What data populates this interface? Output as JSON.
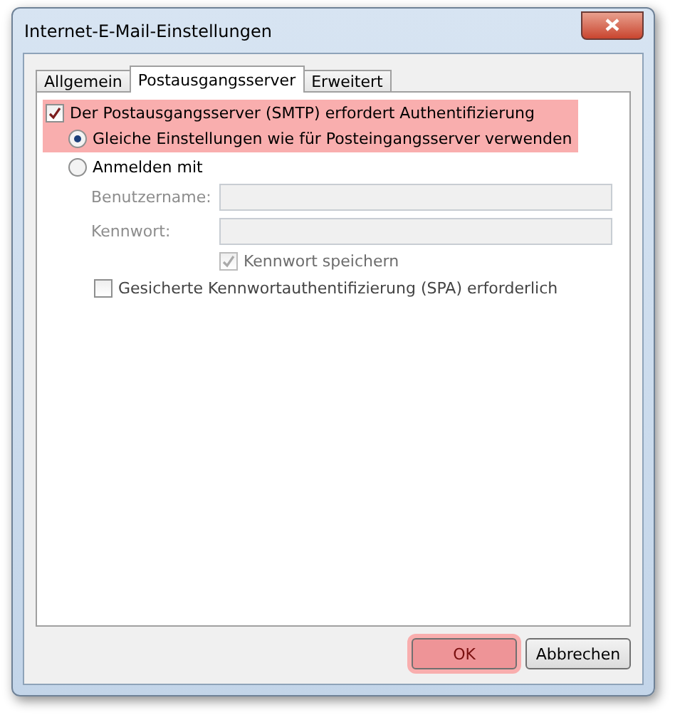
{
  "window": {
    "title": "Internet-E-Mail-Einstellungen"
  },
  "tabs": [
    {
      "label": "Allgemein",
      "selected": false
    },
    {
      "label": "Postausgangsserver",
      "selected": true
    },
    {
      "label": "Erweitert",
      "selected": false
    }
  ],
  "auth": {
    "label": "Der Postausgangsserver (SMTP) erfordert Authentifizierung",
    "checked": true,
    "highlighted": true
  },
  "modes": [
    {
      "label": "Gleiche Einstellungen wie für Posteingangsserver verwenden",
      "selected": true,
      "highlighted": true
    },
    {
      "label": "Anmelden mit",
      "selected": false,
      "highlighted": false
    }
  ],
  "fields": [
    {
      "label": "Benutzername:",
      "disabled": true
    },
    {
      "label": "Kennwort:",
      "disabled": true
    }
  ],
  "save_password": {
    "label": "Kennwort speichern",
    "checked": true,
    "disabled": true
  },
  "spa": {
    "label": "Gesicherte Kennwortauthentifizierung (SPA) erforderlich",
    "checked": false,
    "disabled": false
  },
  "buttons": [
    {
      "label": "OK",
      "highlighted": true
    },
    {
      "label": "Abbrechen",
      "highlighted": false
    }
  ]
}
